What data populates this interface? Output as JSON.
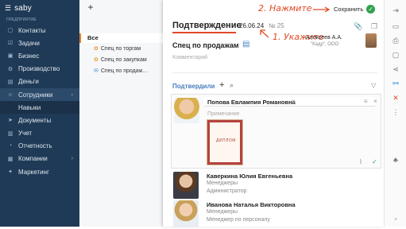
{
  "app": {
    "logo": "saby",
    "company": "ПРЕДПРИЯТИЕ"
  },
  "sidebar": {
    "items": [
      {
        "label": "Контакты",
        "icon": "chat-icon"
      },
      {
        "label": "Задачи",
        "icon": "task-icon"
      },
      {
        "label": "Бизнес",
        "icon": "briefcase-icon"
      },
      {
        "label": "Производство",
        "icon": "factory-icon"
      },
      {
        "label": "Деньги",
        "icon": "money-icon"
      },
      {
        "label": "Сотрудники",
        "icon": "people-icon"
      },
      {
        "label": "Навыки",
        "icon": "skills-icon"
      },
      {
        "label": "Документы",
        "icon": "document-icon"
      },
      {
        "label": "Учет",
        "icon": "ledger-icon"
      },
      {
        "label": "Отчетность",
        "icon": "report-icon"
      },
      {
        "label": "Компании",
        "icon": "company-icon"
      },
      {
        "label": "Маркетинг",
        "icon": "marketing-icon"
      }
    ]
  },
  "folders": {
    "all": "Все",
    "items": [
      "Спец по торгам",
      "Спец по закупкам",
      "Спец по продаж…"
    ]
  },
  "doc": {
    "title": "Подтверждение",
    "date": "26.06.24",
    "number": "№ 25",
    "hint_click": "2. Нажмите",
    "hint_point": "1. Укажите",
    "save_label": "Сохранить",
    "type": "Спец по продажам",
    "comment_placeholder": "Комментарий",
    "author_name": "Алексеев А.А.",
    "author_org": "\"Кадр\", ООО",
    "approvers_label": "Подтвердили"
  },
  "approval_card": {
    "name": "Попова Евлампия Романовна",
    "note_placeholder": "Примечание",
    "diploma_text": "ДИПЛОМ"
  },
  "people": [
    {
      "name": "Каверкина Юлия Евгеньевна",
      "dept": "Менеджеры",
      "role": "Администратор"
    },
    {
      "name": "Иванова Наталья Викторовна",
      "dept": "Менеджеры",
      "role": "Менеджер по персоналу"
    }
  ],
  "colors": {
    "sidebar": "#1f3a56",
    "accent": "#e04a26",
    "link": "#4a7fbd",
    "ok": "#31a24c"
  }
}
